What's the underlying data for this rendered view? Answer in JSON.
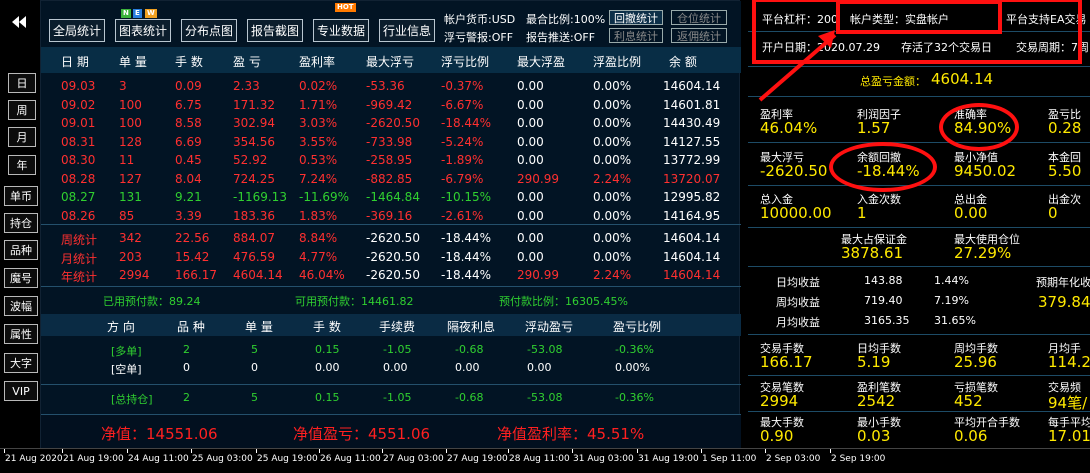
{
  "side_buttons": [
    "日",
    "周",
    "月",
    "年",
    "单币",
    "持仓",
    "品种",
    "魔号",
    "波幅",
    "属性",
    "大字",
    "VIP"
  ],
  "toolbar": {
    "buttons": [
      "全局统计",
      "图表统计",
      "分布点图",
      "报告截图",
      "专业数据",
      "行业信息"
    ],
    "badge_new": [
      "N",
      "E",
      "W"
    ],
    "badge_hot": "HOT",
    "account_currency": "帐户货币:USD",
    "float_warning": "浮亏警报:OFF",
    "max_ratio": "最合比例:100%",
    "report_push": "报告推送:OFF",
    "btn_drawdown_stats": "回撤统计",
    "btn_position_stats": "仓位统计",
    "btn_interest_stats": "利息统计",
    "btn_rebate_stats": "返佣统计"
  },
  "table": {
    "headers": [
      "日 期",
      "单 量",
      "手 数",
      "盈 亏",
      "盈利率",
      "最大浮亏",
      "浮亏比例",
      "最大浮盈",
      "浮盈比例",
      "余 额"
    ],
    "rows": [
      {
        "date": "09.03",
        "orders": "3",
        "lots": "0.09",
        "pnl": "2.33",
        "rate": "0.02%",
        "max_float_loss": "-53.36",
        "float_loss_ratio": "-0.37%",
        "max_float_profit": "0.00",
        "float_profit_ratio": "0.00%",
        "balance": "14604.14",
        "color": "red"
      },
      {
        "date": "09.02",
        "orders": "100",
        "lots": "6.75",
        "pnl": "171.32",
        "rate": "1.71%",
        "max_float_loss": "-969.42",
        "float_loss_ratio": "-6.67%",
        "max_float_profit": "0.00",
        "float_profit_ratio": "0.00%",
        "balance": "14601.81",
        "color": "red"
      },
      {
        "date": "09.01",
        "orders": "100",
        "lots": "8.58",
        "pnl": "302.94",
        "rate": "3.03%",
        "max_float_loss": "-2620.50",
        "float_loss_ratio": "-18.44%",
        "max_float_profit": "0.00",
        "float_profit_ratio": "0.00%",
        "balance": "14430.49",
        "color": "red"
      },
      {
        "date": "08.31",
        "orders": "128",
        "lots": "6.69",
        "pnl": "354.56",
        "rate": "3.55%",
        "max_float_loss": "-733.98",
        "float_loss_ratio": "-5.24%",
        "max_float_profit": "0.00",
        "float_profit_ratio": "0.00%",
        "balance": "14127.55",
        "color": "red"
      },
      {
        "date": "08.30",
        "orders": "11",
        "lots": "0.45",
        "pnl": "52.92",
        "rate": "0.53%",
        "max_float_loss": "-258.95",
        "float_loss_ratio": "-1.89%",
        "max_float_profit": "0.00",
        "float_profit_ratio": "0.00%",
        "balance": "13772.99",
        "color": "red"
      },
      {
        "date": "08.28",
        "orders": "127",
        "lots": "8.04",
        "pnl": "724.25",
        "rate": "7.24%",
        "max_float_loss": "-882.85",
        "float_loss_ratio": "-6.79%",
        "max_float_profit": "290.99",
        "float_profit_ratio": "2.24%",
        "balance": "13720.07",
        "color": "red"
      },
      {
        "date": "08.27",
        "orders": "131",
        "lots": "9.21",
        "pnl": "-1169.13",
        "rate": "-11.69%",
        "max_float_loss": "-1464.84",
        "float_loss_ratio": "-10.15%",
        "max_float_profit": "0.00",
        "float_profit_ratio": "0.00%",
        "balance": "12995.82",
        "color": "green"
      },
      {
        "date": "08.26",
        "orders": "85",
        "lots": "3.39",
        "pnl": "183.36",
        "rate": "1.83%",
        "max_float_loss": "-369.16",
        "float_loss_ratio": "-2.61%",
        "max_float_profit": "0.00",
        "float_profit_ratio": "0.00%",
        "balance": "14164.95",
        "color": "red"
      }
    ],
    "summary_rows": [
      {
        "date": "周统计",
        "orders": "342",
        "lots": "22.56",
        "pnl": "884.07",
        "rate": "8.84%",
        "max_float_loss": "-2620.50",
        "float_loss_ratio": "-18.44%",
        "max_float_profit": "0.00",
        "float_profit_ratio": "0.00%",
        "balance": "14604.14"
      },
      {
        "date": "月统计",
        "orders": "203",
        "lots": "15.42",
        "pnl": "476.59",
        "rate": "4.77%",
        "max_float_loss": "-2620.50",
        "float_loss_ratio": "-18.44%",
        "max_float_profit": "0.00",
        "float_profit_ratio": "0.00%",
        "balance": "14604.14"
      },
      {
        "date": "年统计",
        "orders": "2994",
        "lots": "166.17",
        "pnl": "4604.14",
        "rate": "46.04%",
        "max_float_loss": "-2620.50",
        "float_loss_ratio": "-18.44%",
        "max_float_profit": "290.99",
        "float_profit_ratio": "2.24%",
        "balance": "14604.14"
      }
    ]
  },
  "margin_line": {
    "used_prepay": "已用预付款：89.24",
    "available_prepay": "可用预付款：14461.82",
    "prepay_ratio": "预付款比例：16305.45%"
  },
  "positions": {
    "headers": [
      "方 向",
      "品 种",
      "单 量",
      "手 数",
      "手续费",
      "隔夜利息",
      "浮动盈亏",
      "盈亏比例"
    ],
    "rows": [
      {
        "dir": "[多单]",
        "symbols": "2",
        "orders": "5",
        "lots": "0.15",
        "fee": "-1.05",
        "swap": "-0.68",
        "float_pnl": "-53.08",
        "ratio": "-0.36%",
        "color": "green"
      },
      {
        "dir": "[空单]",
        "symbols": "0",
        "orders": "0",
        "lots": "0.00",
        "fee": "0.00",
        "swap": "0.00",
        "float_pnl": "0.00",
        "ratio": "0.00%",
        "color": "white"
      },
      {
        "dir": "[总持仓]",
        "symbols": "2",
        "orders": "5",
        "lots": "0.15",
        "fee": "-1.05",
        "swap": "-0.68",
        "float_pnl": "-53.08",
        "ratio": "-0.36%",
        "color": "green"
      }
    ]
  },
  "bottom": {
    "net_value": "净值：14551.06",
    "net_pnl": "净值盈亏：4551.06",
    "net_rate": "净值盈利率：45.51%"
  },
  "right_panel": {
    "leverage": "平台杠杆：200",
    "account_type": "帐户类型：实盘帐户",
    "ea_support": "平台支持EA交易",
    "open_date": "开户日期：2020.07.29",
    "survived": "存活了32个交易日",
    "trade_period": "交易周期：7周",
    "total_pnl_label": "总盈亏金额：",
    "total_pnl_value": "4604.14",
    "grid1": [
      {
        "label": "盈利率",
        "value": "46.04%"
      },
      {
        "label": "利润因子",
        "value": "1.57"
      },
      {
        "label": "准确率",
        "value": "84.90%"
      },
      {
        "label": "盈亏比",
        "value": "0.28"
      }
    ],
    "grid2": [
      {
        "label": "最大浮亏",
        "value": "-2620.50"
      },
      {
        "label": "余额回撤",
        "value": "-18.44%"
      },
      {
        "label": "最小净值",
        "value": "9450.02"
      },
      {
        "label": "本金回",
        "value": "5.50"
      }
    ],
    "grid3": [
      {
        "label": "总入金",
        "value": "10000.00"
      },
      {
        "label": "入金次数",
        "value": "1"
      },
      {
        "label": "总出金",
        "value": "0.00"
      },
      {
        "label": "出金次",
        "value": "0"
      }
    ],
    "margin_grid": [
      {
        "label": "最大占保证金",
        "value": "3878.61"
      },
      {
        "label": "最大使用仓位",
        "value": "27.29%"
      }
    ],
    "daily_stats": [
      {
        "label": "日均收益",
        "amount": "143.88",
        "pct": "1.44%"
      },
      {
        "label": "周均收益",
        "amount": "719.40",
        "pct": "7.19%"
      },
      {
        "label": "月均收益",
        "amount": "3165.35",
        "pct": "31.65%"
      }
    ],
    "annual_label": "预期年化收益",
    "annual_value": "379.84%",
    "grid4": [
      {
        "label": "交易手数",
        "value": "166.17"
      },
      {
        "label": "日均手数",
        "value": "5.19"
      },
      {
        "label": "周均手数",
        "value": "25.96"
      },
      {
        "label": "月均手",
        "value": "114.2"
      }
    ],
    "grid5": [
      {
        "label": "交易笔数",
        "value": "2994"
      },
      {
        "label": "盈利笔数",
        "value": "2542"
      },
      {
        "label": "亏损笔数",
        "value": "452"
      },
      {
        "label": "交易频",
        "value": "94笔/"
      }
    ],
    "grid6": [
      {
        "label": "最大手数",
        "value": "0.90"
      },
      {
        "label": "最小手数",
        "value": "0.03"
      },
      {
        "label": "平均开合手数",
        "value": "0.06"
      },
      {
        "label": "每手平均",
        "value": "17.01"
      }
    ]
  },
  "time_axis": [
    "21 Aug 2020",
    "21 Aug 19:00",
    "24 Aug 11:00",
    "25 Aug 03:00",
    "25 Aug 19:00",
    "26 Aug 11:00",
    "27 Aug 03:00",
    "27 Aug 19:00",
    "28 Aug 11:00",
    "31 Aug 03:00",
    "31 Aug 19:00",
    "1 Sep 11:00",
    "2 Sep 03:00",
    "2 Sep 19:00"
  ],
  "colors": {
    "accent_yellow": "#ffe900",
    "loss_red": "#ff3030",
    "gain_green": "#30d030",
    "annotation_red": "#ff1010",
    "header_blue": "#082d45"
  }
}
